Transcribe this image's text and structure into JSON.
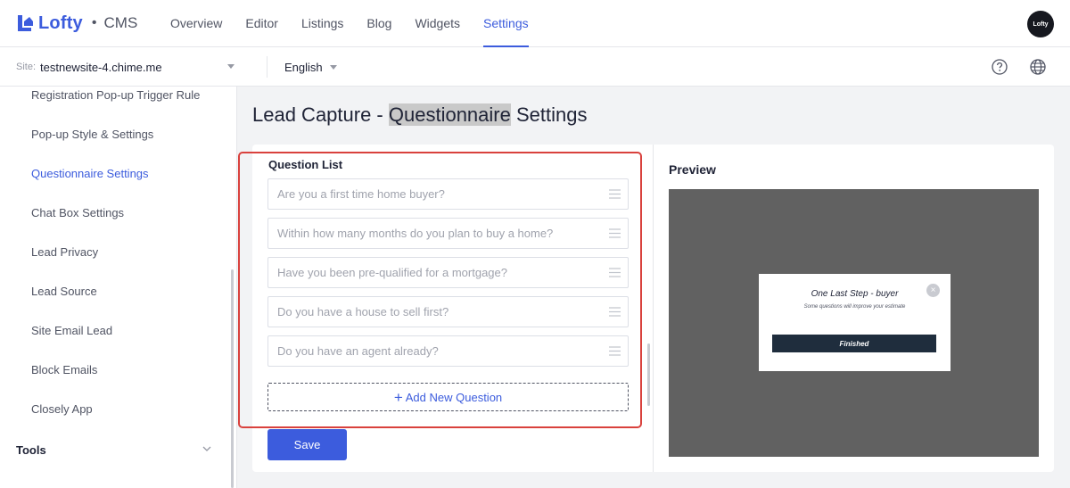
{
  "header": {
    "logo_text": "Lofty",
    "logo_dot": "•",
    "product": "CMS",
    "nav": [
      {
        "label": "Overview"
      },
      {
        "label": "Editor"
      },
      {
        "label": "Listings"
      },
      {
        "label": "Blog"
      },
      {
        "label": "Widgets"
      },
      {
        "label": "Settings",
        "active": true
      }
    ],
    "avatar_text": "Lofty"
  },
  "subbar": {
    "site_label": "Site:",
    "site_value": "testnewsite-4.chime.me",
    "language": "English"
  },
  "sidebar": {
    "items": [
      {
        "label": "Registration Pop-up Trigger Rule"
      },
      {
        "label": "Pop-up Style & Settings"
      },
      {
        "label": "Questionnaire Settings",
        "active": true
      },
      {
        "label": "Chat Box Settings"
      },
      {
        "label": "Lead Privacy"
      },
      {
        "label": "Lead Source"
      },
      {
        "label": "Site Email Lead"
      },
      {
        "label": "Block Emails"
      },
      {
        "label": "Closely App"
      }
    ],
    "section": "Tools"
  },
  "main": {
    "title_prefix": "Lead Capture - ",
    "title_highlight": "Questionnaire",
    "title_suffix": " Settings",
    "question_list_title": "Question List",
    "questions": [
      "Are you a first time home buyer?",
      "Within how many months do you plan to buy a home?",
      "Have you been pre-qualified for a mortgage?",
      "Do you have a house to sell first?",
      "Do you have an agent already?"
    ],
    "add_plus": "+",
    "add_label": "Add New Question",
    "save_label": "Save"
  },
  "preview": {
    "title": "Preview",
    "popup_title": "One Last Step - buyer",
    "popup_subtitle": "Some questions will improve your estimate",
    "popup_close": "×",
    "popup_button": "Finished"
  },
  "colors": {
    "accent": "#3c5cdd",
    "highlight_box": "#d9413d",
    "preview_bg": "#616161",
    "popup_button": "#1f2d3d"
  }
}
